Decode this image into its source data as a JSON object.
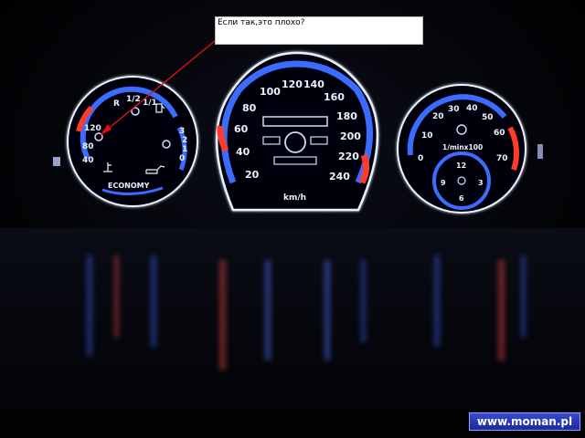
{
  "callout": {
    "text": "Если так,это плохо?"
  },
  "watermark": {
    "text": "www.moman.pl"
  },
  "colors": {
    "background": "#000000",
    "gauge_blue": "#3a6cff",
    "gauge_red": "#ff3a2a",
    "gauge_glow": "#e8f2ff",
    "arrow": "#e01010"
  },
  "left_gauge": {
    "temp_labels": [
      "40",
      "80",
      "120"
    ],
    "fuel_labels": [
      "R",
      "1/2",
      "1/1"
    ],
    "oil_labels": [
      "0",
      "1",
      "2",
      "3"
    ],
    "economy_label": "ECONOMY",
    "icons": [
      "coolant-temperature-icon",
      "fuel-pump-icon",
      "oil-can-icon"
    ]
  },
  "speedometer": {
    "labels": [
      "20",
      "40",
      "60",
      "80",
      "100",
      "120",
      "140",
      "160",
      "180",
      "200",
      "220",
      "240"
    ],
    "unit": "km/h"
  },
  "tachometer": {
    "labels": [
      "0",
      "10",
      "20",
      "30",
      "40",
      "50",
      "60",
      "70"
    ],
    "unit": "1/minx100",
    "clock_labels": [
      "12",
      "3",
      "6",
      "9"
    ]
  }
}
